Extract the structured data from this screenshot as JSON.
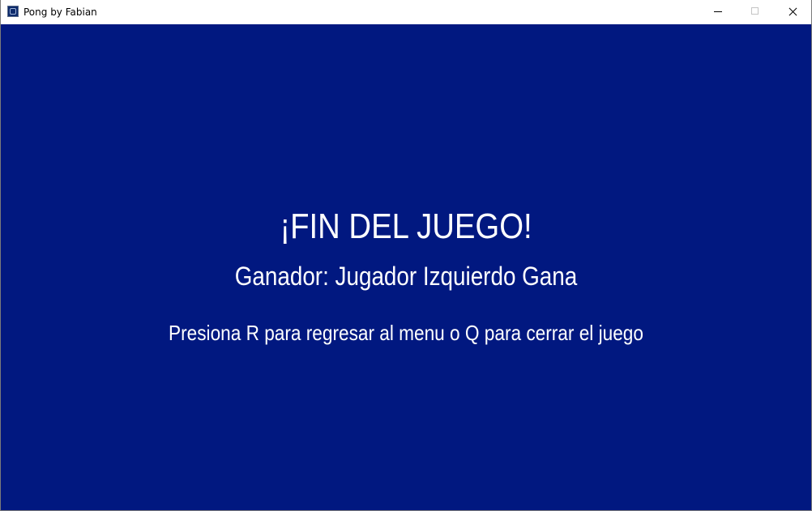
{
  "window": {
    "title": "Pong by Fabian"
  },
  "game": {
    "background_color": "#011880",
    "text_color": "#ffffff",
    "title": "¡FIN DEL JUEGO!",
    "winner": "Ganador: Jugador Izquierdo Gana",
    "instructions": "Presiona R para regresar al menu o Q para cerrar el juego"
  }
}
